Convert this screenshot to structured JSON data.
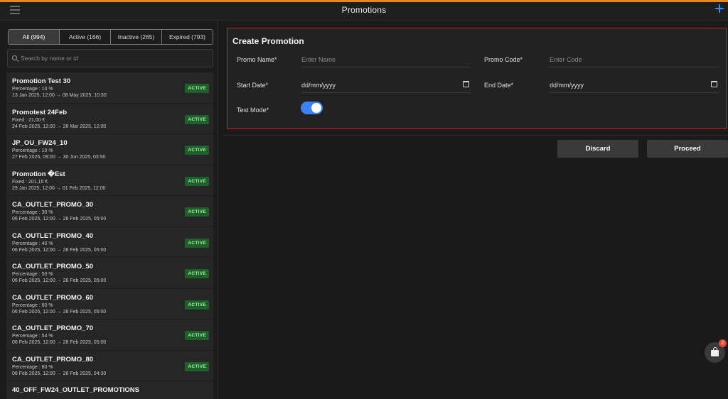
{
  "header": {
    "title": "Promotions",
    "menu_icon": "hamburger-menu-icon",
    "add_icon": "plus-icon",
    "accent_color": "#e58a1f"
  },
  "sidebar": {
    "tabs": [
      {
        "label": "All (994)",
        "active": true
      },
      {
        "label": "Active (166)",
        "active": false
      },
      {
        "label": "Inactive (265)",
        "active": false
      },
      {
        "label": "Expired (793)",
        "active": false
      }
    ],
    "search": {
      "placeholder": "Search by name or id"
    },
    "promotions": [
      {
        "name": "Promotion Test 30",
        "value": "Percentage : 10 %",
        "dates": "13 Jan 2025, 12:00 → 08 May 2025, 10:30",
        "status": "ACTIVE"
      },
      {
        "name": "Promotest 24Feb",
        "value": "Fixed : 21,00 €",
        "dates": "24 Feb 2025, 12:00 → 28 Mar 2025, 12:00",
        "status": "ACTIVE"
      },
      {
        "name": "JP_OU_FW24_10",
        "value": "Percentage : 10 %",
        "dates": "27 Feb 2025, 09:00 → 30 Jun 2025, 03:50",
        "status": "ACTIVE"
      },
      {
        "name": "Promotion �Est",
        "value": "Fixed : 201,15 €",
        "dates": "29 Jan 2025, 12:00 → 01 Feb 2025, 12:00",
        "status": "ACTIVE"
      },
      {
        "name": "CA_OUTLET_PROMO_30",
        "value": "Percentage : 30 %",
        "dates": "06 Feb 2025, 12:00 → 28 Feb 2025, 05:00",
        "status": "ACTIVE"
      },
      {
        "name": "CA_OUTLET_PROMO_40",
        "value": "Percentage : 40 %",
        "dates": "06 Feb 2025, 12:00 → 28 Feb 2025, 05:00",
        "status": "ACTIVE"
      },
      {
        "name": "CA_OUTLET_PROMO_50",
        "value": "Percentage : 50 %",
        "dates": "06 Feb 2025, 12:00 → 28 Feb 2025, 05:00",
        "status": "ACTIVE"
      },
      {
        "name": "CA_OUTLET_PROMO_60",
        "value": "Percentage : 60 %",
        "dates": "06 Feb 2025, 12:00 → 28 Feb 2025, 05:00",
        "status": "ACTIVE"
      },
      {
        "name": "CA_OUTLET_PROMO_70",
        "value": "Percentage : 54 %",
        "dates": "06 Feb 2025, 12:00 → 28 Feb 2025, 05:00",
        "status": "ACTIVE"
      },
      {
        "name": "CA_OUTLET_PROMO_80",
        "value": "Percentage : 80 %",
        "dates": "06 Feb 2025, 12:00 → 28 Feb 2025, 04:30",
        "status": "ACTIVE"
      },
      {
        "name": "40_OFF_FW24_OUTLET_PROMOTIONS",
        "value": "",
        "dates": "",
        "status": ""
      }
    ]
  },
  "create_promotion": {
    "title": "Create Promotion",
    "promo_name": {
      "label": "Promo Name*",
      "placeholder": "Enter Name"
    },
    "promo_code": {
      "label": "Promo Code*",
      "placeholder": "Enter Code"
    },
    "start_date": {
      "label": "Start Date*",
      "value": "dd/mm/yyyy"
    },
    "end_date": {
      "label": "End Date*",
      "value": "dd/mm/yyyy"
    },
    "test_mode": {
      "label": "Test Mode*",
      "enabled": true
    },
    "highlight_color": "#d0202a",
    "toggle_color": "#3b82f6"
  },
  "actions": {
    "discard_label": "Discard",
    "proceed_label": "Proceed"
  },
  "cart": {
    "icon": "shopping-bag-icon",
    "badge_count": "2"
  }
}
